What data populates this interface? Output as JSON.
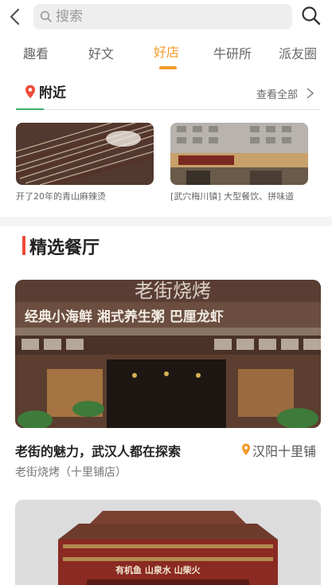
{
  "header": {
    "back_icon": "chevron-left-icon",
    "search_placeholder": "搜索",
    "search_icon": "search-icon"
  },
  "tabs": [
    {
      "label": "趣看",
      "active": false
    },
    {
      "label": "好文",
      "active": false
    },
    {
      "label": "好店",
      "active": true
    },
    {
      "label": "牛研所",
      "active": false
    },
    {
      "label": "派友圈",
      "active": false
    }
  ],
  "nearby": {
    "title": "附近",
    "see_all": "查看全部",
    "items": [
      {
        "caption": "开了20年的青山麻辣烫"
      },
      {
        "caption": "[武穴梅川镇] 大型餐饮、拼味道"
      }
    ]
  },
  "featured": {
    "title": "精选餐厅",
    "items": [
      {
        "title": "老街的魅力，武汉人都在探索",
        "location": "汉阳十里铺",
        "subtitle": "老街烧烤（十里铺店）",
        "sign_top": "老街烧烤",
        "sign_banner": "经典小海鲜  湘式养生粥  巴厘龙虾"
      },
      {
        "sign_text": "有机鱼 山泉水 山柴火"
      }
    ]
  },
  "colors": {
    "accent": "#f39a2b",
    "section_bar": "#f04a3a",
    "pin_red": "#f04a3a",
    "divider_green": "#41b06e"
  }
}
